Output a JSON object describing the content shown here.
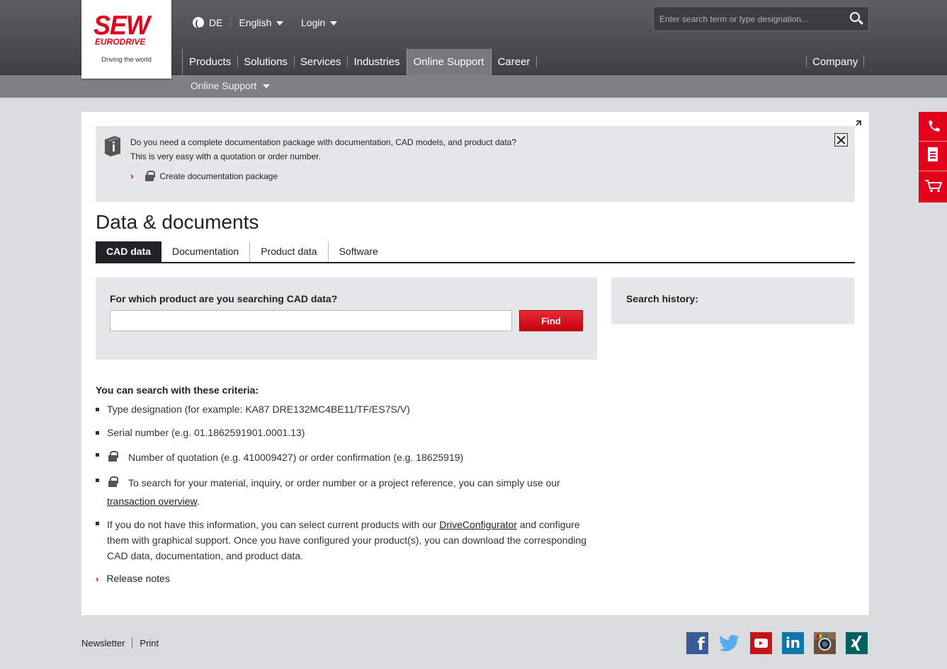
{
  "brand": {
    "name": "SEW",
    "sub": "EURODRIVE",
    "tagline": "Driving the world"
  },
  "header": {
    "country": "DE",
    "language": "English",
    "login": "Login",
    "search_placeholder": "Enter search term or type designation...",
    "nav": [
      "Products",
      "Solutions",
      "Services",
      "Industries",
      "Online Support",
      "Career"
    ],
    "nav_active": "Online Support",
    "company": "Company",
    "subnav": "Online Support"
  },
  "sidetools": [
    "phone-icon",
    "document-icon",
    "cart-icon"
  ],
  "infobox": {
    "line1": "Do you need a complete documentation package with documentation, CAD models, and product data?",
    "line2": "This is very easy with a quotation or order number.",
    "link": "Create documentation package"
  },
  "page_title": "Data & documents",
  "tabs": [
    "CAD data",
    "Documentation",
    "Product data",
    "Software"
  ],
  "active_tab": "CAD data",
  "search": {
    "question": "For which product are you searching CAD data?",
    "value": "",
    "button": "Find"
  },
  "history": {
    "title": "Search history:"
  },
  "criteria": {
    "title": "You can search with these criteria:",
    "item1": "Type designation (for example: KA87 DRE132MC4BE11/TF/ES7S/V)",
    "item2": "Serial number (e.g. 01.1862591901.0001.13)",
    "item3": "Number of quotation (e.g. 410009427) or order confirmation (e.g. 18625919)",
    "item4_a": "To search for your material, inquiry, or order number or a project reference, you can simply use our",
    "item4_link": "transaction overview",
    "item4_end": ".",
    "item5_a": "If you do not have this information, you can select current products with our",
    "item5_link": "DriveConfigurator",
    "item5_b": "and configure",
    "item5_line2": "them with graphical support. Once you have configured your product(s), you can download the corresponding",
    "item5_line3": "CAD data, documentation, and product data.",
    "release_notes": "Release notes"
  },
  "footer": {
    "links": [
      "Newsletter",
      "Print"
    ],
    "social": [
      "facebook-icon",
      "twitter-icon",
      "youtube-icon",
      "linkedin-icon",
      "instagram-icon",
      "xing-icon"
    ]
  }
}
